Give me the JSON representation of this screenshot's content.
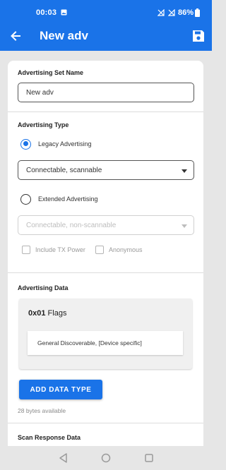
{
  "status_bar": {
    "time": "00:03",
    "battery_percent": "86%",
    "icons": [
      "image-icon",
      "no-signal-icon",
      "no-signal-icon",
      "battery-icon"
    ]
  },
  "app_bar": {
    "title": "New adv",
    "back_icon": "arrow-back-icon",
    "save_icon": "save-icon"
  },
  "advertising_set": {
    "label": "Advertising Set Name",
    "value": "New adv"
  },
  "advertising_type": {
    "label": "Advertising Type",
    "legacy": {
      "label": "Legacy Advertising",
      "selected": true,
      "option": "Connectable, scannable"
    },
    "extended": {
      "label": "Extended Advertising",
      "selected": false,
      "option": "Connectable, non-scannable"
    },
    "include_tx_power": "Include TX Power",
    "anonymous": "Anonymous"
  },
  "advertising_data": {
    "label": "Advertising Data",
    "flag_code": "0x01",
    "flag_name": "Flags",
    "flag_value": "General Discoverable, [Device specific]",
    "add_button": "ADD DATA TYPE",
    "bytes_available": "28 bytes available"
  },
  "scan_response": {
    "label": "Scan Response Data"
  },
  "colors": {
    "primary": "#1a73e8",
    "background": "#e6e6e6"
  },
  "nav_bar": {
    "icons": [
      "back-triangle-icon",
      "home-circle-icon",
      "recents-square-icon"
    ]
  }
}
